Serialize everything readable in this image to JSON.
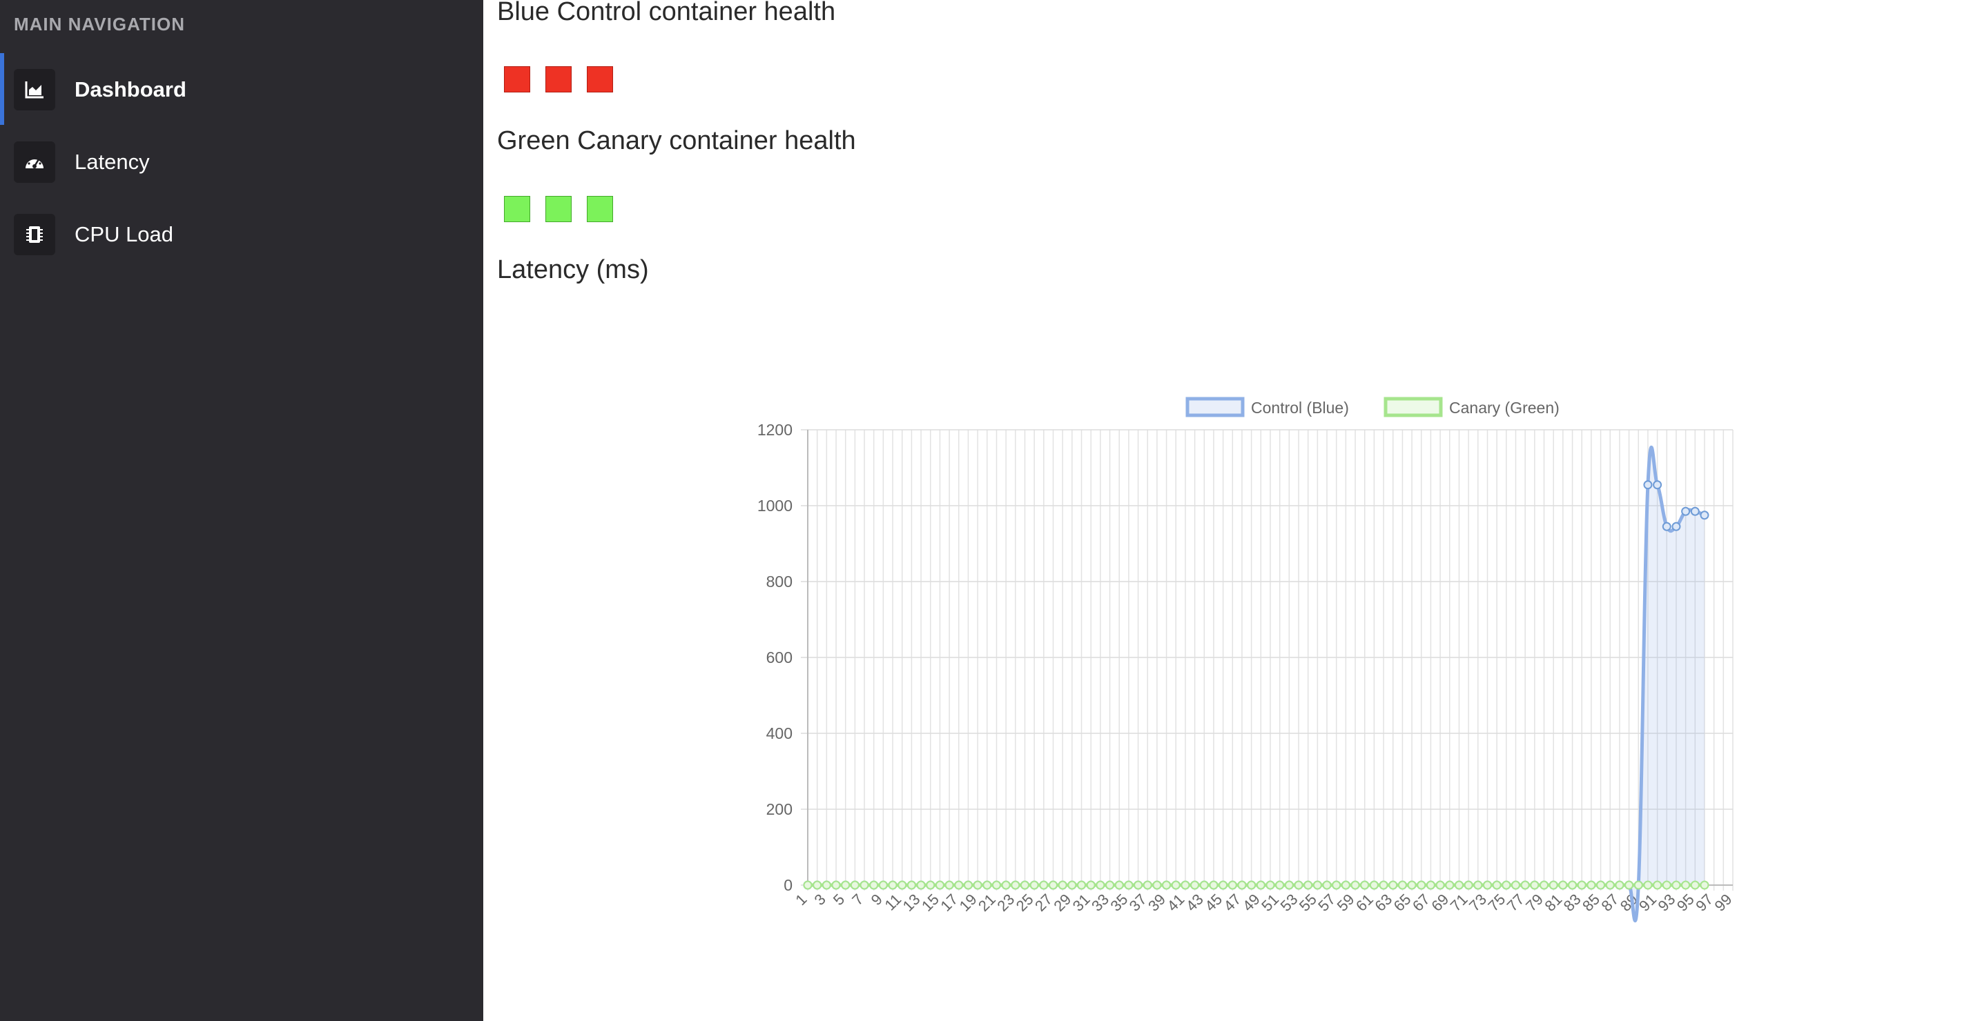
{
  "sidebar": {
    "heading": "MAIN NAVIGATION",
    "items": [
      {
        "label": "Dashboard",
        "icon": "area-chart-icon",
        "active": true
      },
      {
        "label": "Latency",
        "icon": "speedometer-icon",
        "active": false
      },
      {
        "label": "CPU Load",
        "icon": "cpu-chip-icon",
        "active": false
      }
    ]
  },
  "main": {
    "blue_title": "Blue Control container health",
    "green_title": "Green Canary container health",
    "latency_title": "Latency (ms)",
    "blue_health": [
      "unhealthy",
      "unhealthy",
      "unhealthy"
    ],
    "green_health": [
      "healthy",
      "healthy",
      "healthy"
    ]
  },
  "colors": {
    "sidebar_bg": "#2b2a2f",
    "accent": "#3a73d9",
    "unhealthy": "#ee3224",
    "healthy": "#7cf25a",
    "control_line": "#8fb0e6",
    "canary_line": "#a6e58d"
  },
  "chart_data": {
    "type": "line",
    "title": "",
    "xlabel": "",
    "ylabel": "",
    "ylim": [
      0,
      1200
    ],
    "yticks": [
      0,
      200,
      400,
      600,
      800,
      1000,
      1200
    ],
    "x_range": [
      1,
      99
    ],
    "x_tick_step": 2,
    "grid": true,
    "legend": "top-center",
    "series": [
      {
        "name": "Control (Blue)",
        "color": "#8fb0e6",
        "fill": true,
        "x": [
          1,
          2,
          3,
          4,
          5,
          6,
          7,
          8,
          9,
          10,
          11,
          12,
          13,
          14,
          15,
          16,
          17,
          18,
          19,
          20,
          21,
          22,
          23,
          24,
          25,
          26,
          27,
          28,
          29,
          30,
          31,
          32,
          33,
          34,
          35,
          36,
          37,
          38,
          39,
          40,
          41,
          42,
          43,
          44,
          45,
          46,
          47,
          48,
          49,
          50,
          51,
          52,
          53,
          54,
          55,
          56,
          57,
          58,
          59,
          60,
          61,
          62,
          63,
          64,
          65,
          66,
          67,
          68,
          69,
          70,
          71,
          72,
          73,
          74,
          75,
          76,
          77,
          78,
          79,
          80,
          81,
          82,
          83,
          84,
          85,
          86,
          87,
          88,
          89,
          90,
          91,
          92,
          93,
          94,
          95,
          96
        ],
        "values": [
          0,
          0,
          0,
          0,
          0,
          0,
          0,
          0,
          0,
          0,
          0,
          0,
          0,
          0,
          0,
          0,
          0,
          0,
          0,
          0,
          0,
          0,
          0,
          0,
          0,
          0,
          0,
          0,
          0,
          0,
          0,
          0,
          0,
          0,
          0,
          0,
          0,
          0,
          0,
          0,
          0,
          0,
          0,
          0,
          0,
          0,
          0,
          0,
          0,
          0,
          0,
          0,
          0,
          0,
          0,
          0,
          0,
          0,
          0,
          0,
          0,
          0,
          0,
          0,
          0,
          0,
          0,
          0,
          0,
          0,
          0,
          0,
          0,
          0,
          0,
          0,
          0,
          0,
          0,
          0,
          0,
          0,
          0,
          0,
          0,
          0,
          0,
          0,
          0,
          1055,
          1055,
          945,
          945,
          985,
          985,
          975
        ]
      },
      {
        "name": "Canary (Green)",
        "color": "#a6e58d",
        "fill": false,
        "x": [
          1,
          2,
          3,
          4,
          5,
          6,
          7,
          8,
          9,
          10,
          11,
          12,
          13,
          14,
          15,
          16,
          17,
          18,
          19,
          20,
          21,
          22,
          23,
          24,
          25,
          26,
          27,
          28,
          29,
          30,
          31,
          32,
          33,
          34,
          35,
          36,
          37,
          38,
          39,
          40,
          41,
          42,
          43,
          44,
          45,
          46,
          47,
          48,
          49,
          50,
          51,
          52,
          53,
          54,
          55,
          56,
          57,
          58,
          59,
          60,
          61,
          62,
          63,
          64,
          65,
          66,
          67,
          68,
          69,
          70,
          71,
          72,
          73,
          74,
          75,
          76,
          77,
          78,
          79,
          80,
          81,
          82,
          83,
          84,
          85,
          86,
          87,
          88,
          89,
          90,
          91,
          92,
          93,
          94,
          95,
          96
        ],
        "values": [
          0,
          0,
          0,
          0,
          0,
          0,
          0,
          0,
          0,
          0,
          0,
          0,
          0,
          0,
          0,
          0,
          0,
          0,
          0,
          0,
          0,
          0,
          0,
          0,
          0,
          0,
          0,
          0,
          0,
          0,
          0,
          0,
          0,
          0,
          0,
          0,
          0,
          0,
          0,
          0,
          0,
          0,
          0,
          0,
          0,
          0,
          0,
          0,
          0,
          0,
          0,
          0,
          0,
          0,
          0,
          0,
          0,
          0,
          0,
          0,
          0,
          0,
          0,
          0,
          0,
          0,
          0,
          0,
          0,
          0,
          0,
          0,
          0,
          0,
          0,
          0,
          0,
          0,
          0,
          0,
          0,
          0,
          0,
          0,
          0,
          0,
          0,
          0,
          0,
          0,
          0,
          0,
          0,
          0,
          0,
          0
        ]
      }
    ]
  }
}
